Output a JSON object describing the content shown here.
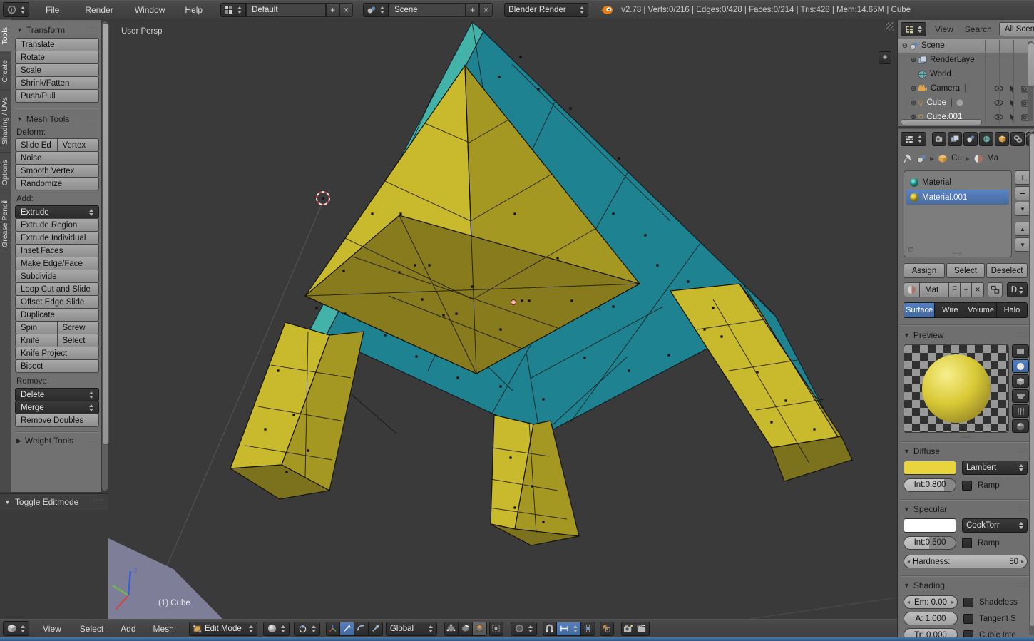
{
  "topbar": {
    "menus": [
      "File",
      "Render",
      "Window",
      "Help"
    ],
    "layout_value": "Default",
    "scene_value": "Scene",
    "engine_value": "Blender Render",
    "stats": "v2.78 | Verts:0/216 | Edges:0/428 | Faces:0/214 | Tris:428 | Mem:14.65M | Cube"
  },
  "tool_tabs": {
    "items": [
      "Tools",
      "Create",
      "Shading / UVs",
      "Options",
      "Grease Pencil"
    ],
    "active": "Tools"
  },
  "shelf": {
    "transform_title": "Transform",
    "transform_buttons": [
      "Translate",
      "Rotate",
      "Scale",
      "Shrink/Fatten",
      "Push/Pull"
    ],
    "meshtools_title": "Mesh Tools",
    "deform_label": "Deform:",
    "slide_ed": "Slide Ed",
    "vertex": "Vertex",
    "deform_buttons": [
      "Noise",
      "Smooth Vertex",
      "Randomize"
    ],
    "add_label": "Add:",
    "extrude_menu": "Extrude",
    "add_buttons": [
      "Extrude Region",
      "Extrude Individual",
      "Inset Faces",
      "Make Edge/Face",
      "Subdivide",
      "Loop Cut and Slide",
      "Offset Edge Slide",
      "Duplicate"
    ],
    "spin": "Spin",
    "screw": "Screw",
    "knife": "Knife",
    "select": "Select",
    "tail_buttons": [
      "Knife Project",
      "Bisect"
    ],
    "remove_label": "Remove:",
    "delete_menu": "Delete",
    "merge_menu": "Merge",
    "remove_doubles": "Remove Doubles",
    "weight_tools_title": "Weight Tools",
    "operator_title": "Toggle Editmode"
  },
  "viewport": {
    "view_label": "User Persp",
    "object_label": "(1) Cube",
    "axis_z_label": "z",
    "colors": {
      "background": "#3a3a3a",
      "table_top": "#1f8290",
      "table_rim": "#43b3a9",
      "leg_bright": "#c9b92c",
      "leg_shade": "#a59822",
      "leg_cap": "#7c721d",
      "column_bottom": "#877b1d",
      "wire": "#101010",
      "floor": "#7e7e99"
    }
  },
  "outliner": {
    "menus": [
      "View",
      "Search"
    ],
    "scenes_filter": "All Scene",
    "items": [
      {
        "label": "Scene"
      },
      {
        "label": "RenderLaye"
      },
      {
        "label": "World"
      },
      {
        "label": "Camera"
      },
      {
        "label": "Cube"
      },
      {
        "label": "Cube.001"
      }
    ]
  },
  "properties": {
    "breadcrumb": {
      "object": "Cu",
      "material": "Ma"
    },
    "slots": [
      {
        "name": "Material"
      },
      {
        "name": "Material.001"
      }
    ],
    "assign": "Assign",
    "select": "Select",
    "deselect": "Deselect",
    "datablock": {
      "name": "Mat",
      "fake": "F",
      "link": "D"
    },
    "type_toggle": [
      "Surface",
      "Wire",
      "Volume",
      "Halo"
    ],
    "panels": {
      "preview": "Preview",
      "diffuse": "Diffuse",
      "specular": "Specular",
      "shading": "Shading"
    },
    "diffuse": {
      "shader": "Lambert",
      "intensity": "Int:0.800",
      "ramp": "Ramp",
      "color": "#e8d43c"
    },
    "specular": {
      "shader": "CookTorr",
      "intensity": "Int:0.500",
      "ramp": "Ramp",
      "hardness_label": "Hardness:",
      "hardness_value": "50",
      "color": "#ffffff"
    },
    "shading": {
      "emit": "Em: 0.00",
      "alpha": "A: 1.000",
      "translucency": "Tr: 0.000",
      "shadeless": "Shadeless",
      "tangent": "Tangent S",
      "cubic": "Cubic Inte"
    }
  },
  "bottombar": {
    "menus": [
      "View",
      "Select",
      "Add",
      "Mesh"
    ],
    "mode": "Edit Mode",
    "orientation": "Global"
  }
}
